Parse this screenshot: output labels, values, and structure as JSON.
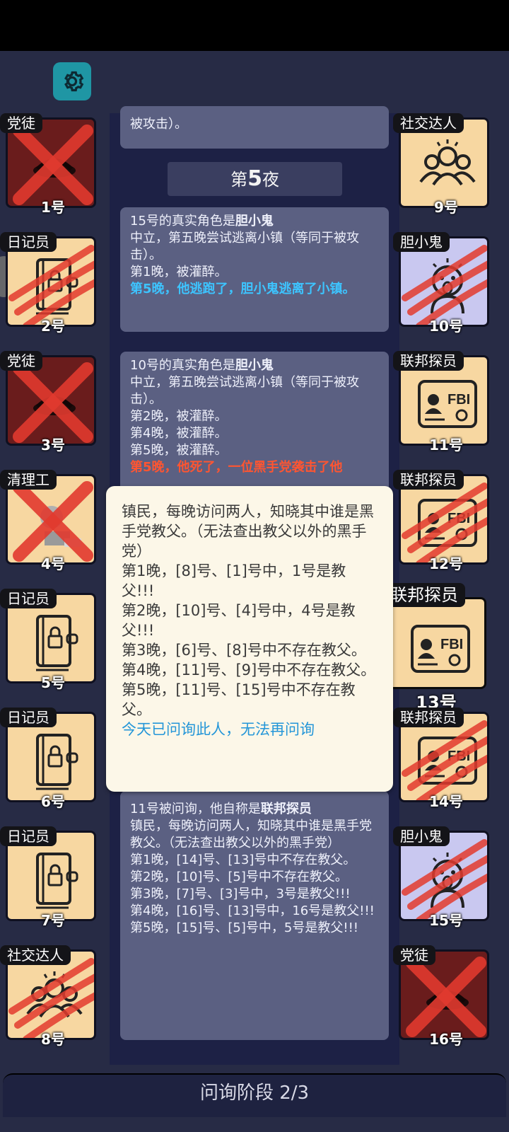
{
  "settings_icon": "gear-icon",
  "night_header": {
    "prefix": "第",
    "number": "5",
    "suffix": "夜"
  },
  "log": {
    "top_fragment": "被攻击）。",
    "entry1": {
      "lead": "15号的真实角色是",
      "role": "胆小鬼",
      "lines": [
        "中立，第五晚尝试逃离小镇（等同于被攻击）。",
        "第1晚，被灌醉。"
      ],
      "highlight": "第5晚，他逃跑了，胆小鬼逃离了小镇。"
    },
    "entry2": {
      "lead": "10号的真实角色是",
      "role": "胆小鬼",
      "lines": [
        "中立，第五晚尝试逃离小镇（等同于被攻击）。",
        "第2晚，被灌醉。",
        "第4晚，被灌醉。",
        "第5晚，被灌醉。"
      ],
      "highlight": "第5晚，他死了，一位黑手党袭击了他"
    },
    "entry3": {
      "lead": "11号被问询，他自称是",
      "role": "联邦探员",
      "lines": [
        "镇民，每晚访问两人，知晓其中谁是黑手党教父。（无法查出教父以外的黑手党）",
        "第1晚，[14]号、[13]号中不存在教父。",
        "第2晚，[10]号、[5]号中不存在教父。",
        "第3晚，[7]号、[3]号中，3号是教父!!!",
        "第4晚，[16]号、[13]号中，16号是教父!!!",
        "第5晚，[15]号、[5]号中，5号是教父!!!"
      ]
    }
  },
  "popup": {
    "description": "镇民，每晚访问两人，知晓其中谁是黑手党教父。（无法查出教父以外的黑手党）",
    "lines": [
      "第1晚，[8]号、[1]号中，1号是教父!!!",
      "第2晚，[10]号、[4]号中，4号是教父!!!",
      "第3晚，[6]号、[8]号中不存在教父。",
      "第4晚，[11]号、[9]号中不存在教父。",
      "第5晚，[11]号、[15]号中不存在教父。"
    ],
    "note": "今天已问询此人，无法再问询"
  },
  "players_left": [
    {
      "role": "党徒",
      "num": "1号",
      "icon": "mafia-icon",
      "status": "eliminated"
    },
    {
      "role": "日记员",
      "num": "2号",
      "icon": "diary-lock-icon",
      "status": "killed"
    },
    {
      "role": "党徒",
      "num": "3号",
      "icon": "mafia-icon",
      "status": "eliminated"
    },
    {
      "role": "清理工",
      "num": "4号",
      "icon": "cleaner-icon",
      "status": "eliminated"
    },
    {
      "role": "日记员",
      "num": "5号",
      "icon": "diary-lock-icon",
      "status": "alive"
    },
    {
      "role": "日记员",
      "num": "6号",
      "icon": "diary-lock-icon",
      "status": "alive"
    },
    {
      "role": "日记员",
      "num": "7号",
      "icon": "diary-lock-icon",
      "status": "alive"
    },
    {
      "role": "社交达人",
      "num": "8号",
      "icon": "socialite-icon",
      "status": "killed"
    }
  ],
  "players_right": [
    {
      "role": "社交达人",
      "num": "9号",
      "icon": "socialite-icon",
      "status": "alive"
    },
    {
      "role": "胆小鬼",
      "num": "10号",
      "icon": "coward-icon",
      "status": "killed"
    },
    {
      "role": "联邦探员",
      "num": "11号",
      "icon": "fbi-badge-icon",
      "status": "alive"
    },
    {
      "role": "联邦探员",
      "num": "12号",
      "icon": "fbi-badge-icon",
      "status": "killed"
    },
    {
      "role": "联邦探员",
      "num": "13号",
      "icon": "fbi-badge-icon",
      "status": "selected"
    },
    {
      "role": "联邦探员",
      "num": "14号",
      "icon": "fbi-badge-icon",
      "status": "killed"
    },
    {
      "role": "胆小鬼",
      "num": "15号",
      "icon": "coward-icon",
      "status": "killed"
    },
    {
      "role": "党徒",
      "num": "16号",
      "icon": "mafia-icon",
      "status": "eliminated"
    }
  ],
  "footer": {
    "phase": "问询阶段 2/3"
  },
  "colors": {
    "background": "#272b45",
    "panel": "#1d2145",
    "bubble": "#5b6082",
    "card": "#f7d7a1",
    "highlight_blue": "#3dc4ff",
    "highlight_red": "#ff5531",
    "accent_teal": "#1f96a4"
  }
}
